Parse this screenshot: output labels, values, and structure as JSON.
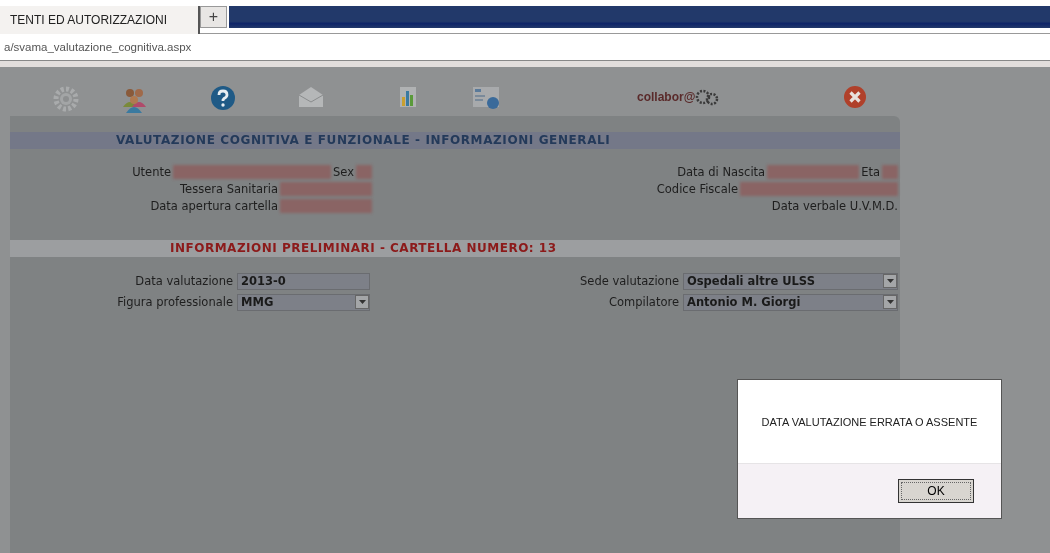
{
  "browser": {
    "tab_title": "TENTI ED AUTORIZZAZIONI",
    "new_tab_button": "+",
    "url": "a/svama_valutazione_cognitiva.aspx"
  },
  "toolbar": {
    "logo_text": "collabor@"
  },
  "header": {
    "title": "VALUTAZIONE COGNITIVA E FUNZIONALE - INFORMAZIONI GENERALI"
  },
  "patient_info": {
    "left": [
      [
        {
          "label": "Utente",
          "redacted": true
        },
        {
          "label": "Sex",
          "redacted": true
        }
      ],
      [
        {
          "label": "Tessera Sanitaria",
          "redacted": true
        }
      ],
      [
        {
          "label": "Data apertura cartella",
          "redacted": true
        }
      ]
    ],
    "right": [
      [
        {
          "label": "Data di Nascita",
          "redacted": true
        },
        {
          "label": "Eta",
          "redacted": true
        }
      ],
      [
        {
          "label": "Codice Fiscale",
          "redacted": true
        }
      ],
      [
        {
          "label": "Data verbale U.V.M.D."
        }
      ]
    ]
  },
  "section": {
    "title": "INFORMAZIONI PRELIMINARI - CARTELLA NUMERO: 13"
  },
  "form": {
    "left": [
      {
        "label": "Data valutazione",
        "value": "2013-0",
        "kind": "text"
      },
      {
        "label": "Figura professionale",
        "value": "MMG",
        "kind": "select"
      }
    ],
    "right": [
      {
        "label": "Sede valutazione",
        "value": "Ospedali altre ULSS",
        "kind": "select"
      },
      {
        "label": "Compilatore",
        "value": "Antonio M. Giorgi",
        "kind": "select"
      }
    ]
  },
  "dialog": {
    "message": "DATA VALUTAZIONE ERRATA O ASSENTE",
    "button": "OK"
  }
}
